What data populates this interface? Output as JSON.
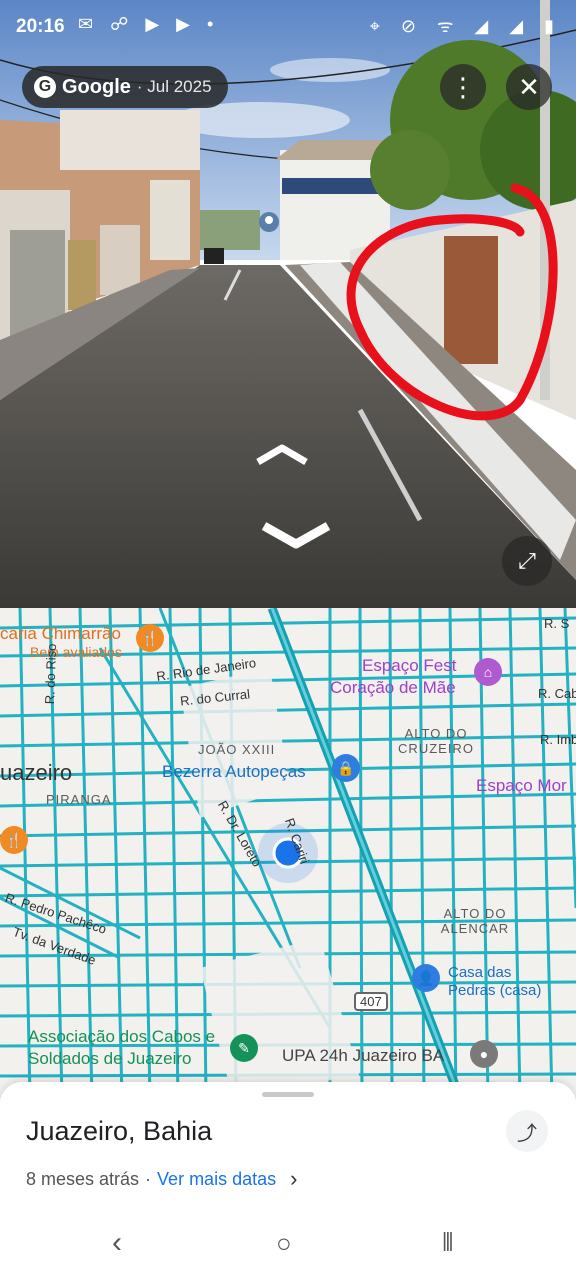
{
  "status_bar": {
    "time": "20:16",
    "left_icons": "✉ ☍ ▶ ▶ •",
    "right_icons": "⌖ ⊘ ᯤ ◢ ◢ ▮"
  },
  "street_view": {
    "provider": "Google",
    "date": "· Jul 2025",
    "menu_icon": "⋮",
    "close_icon": "✕",
    "expand_icon": "⤢",
    "nav_up": "︿",
    "nav_down": "﹀"
  },
  "map": {
    "labels": {
      "pizzaria": "caria Chimarrão",
      "bem_avaliados": "Bem avaliados",
      "r_rio_janeiro": "R. Rio de Janeiro",
      "r_do_curral": "R. do Curral",
      "r_do_riso": "R. do Riso",
      "joao_xxiii": "JOÃO XXIII",
      "bezerra": "Bezerra Autopeças",
      "uazeiro": "uazeiro",
      "piranga": "PIRANGA",
      "r_dr_loreto": "R. Dr. Loreto",
      "r_cariri": "R. Cariri",
      "r_pedro_pacheco": "R. Pedro Pachêco",
      "tv_da_verdade": "Tv. da Verdade",
      "espaco_fest": "Espaço Fest",
      "coracao_mae": "Coração de Mãe",
      "alto_cruzeiro": "ALTO DO CRUZEIRO",
      "espaco_mor": "Espaço Mor",
      "r_cab": "R. Cab",
      "r_imb": "R. Imb",
      "r_s": "R. S",
      "alto_alencar": "ALTO DO ALENCAR",
      "casa_pedras": "Casa das Pedras (casa)",
      "route_407": "407",
      "associacao": "Associação dos Cabos e Soldados de Juazeiro",
      "upa": "UPA 24h Juazeiro BA"
    }
  },
  "sheet": {
    "title": "Juazeiro, Bahia",
    "ago": "8 meses atrás",
    "separator": "·",
    "more_dates": "Ver mais datas",
    "chevron": "›",
    "share_icon": "⤴"
  },
  "system_nav": {
    "back": "‹",
    "home": "○",
    "recents": "|||"
  },
  "colors": {
    "road": "#19aec0",
    "annotation": "#e8101a",
    "accent_link": "#1a73e8",
    "location_dot": "#1a73e8"
  }
}
